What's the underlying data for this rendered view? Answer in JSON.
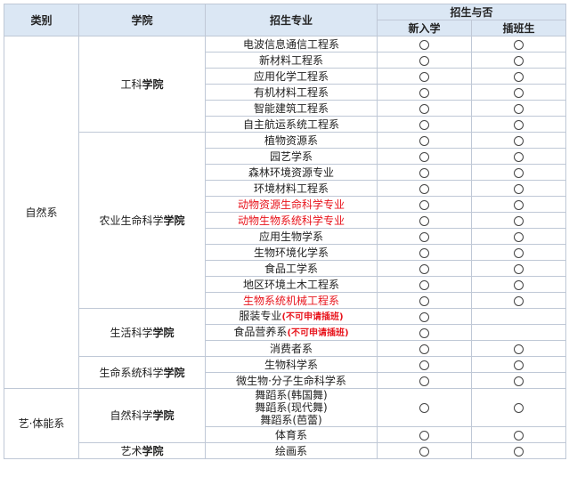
{
  "header": {
    "category": "类别",
    "college": "学院",
    "major": "招生专业",
    "admission": "招生与否",
    "freshman": "新入学",
    "transfer": "插班生"
  },
  "groups": [
    {
      "category": "自然系",
      "colleges": [
        {
          "name": "工科",
          "suffix": "学院",
          "majors": [
            {
              "name": "电波信息通信工程系",
              "red": false,
              "freshman": true,
              "transfer": true
            },
            {
              "name": "新材料工程系",
              "red": false,
              "freshman": true,
              "transfer": true
            },
            {
              "name": "应用化学工程系",
              "red": false,
              "freshman": true,
              "transfer": true
            },
            {
              "name": "有机材料工程系",
              "red": false,
              "freshman": true,
              "transfer": true
            },
            {
              "name": "智能建筑工程系",
              "red": false,
              "freshman": true,
              "transfer": true
            },
            {
              "name": "自主航运系统工程系",
              "red": false,
              "freshman": true,
              "transfer": true
            }
          ]
        },
        {
          "name": "农业生命科学",
          "suffix": "学院",
          "majors": [
            {
              "name": "植物资源系",
              "red": false,
              "freshman": true,
              "transfer": true
            },
            {
              "name": "园艺学系",
              "red": false,
              "freshman": true,
              "transfer": true
            },
            {
              "name": "森林环境资源专业",
              "red": false,
              "freshman": true,
              "transfer": true
            },
            {
              "name": "环境材料工程系",
              "red": false,
              "freshman": true,
              "transfer": true
            },
            {
              "name": "动物资源生命科学专业",
              "red": true,
              "freshman": true,
              "transfer": true
            },
            {
              "name": "动物生物系统科学专业",
              "red": true,
              "freshman": true,
              "transfer": true
            },
            {
              "name": "应用生物学系",
              "red": false,
              "freshman": true,
              "transfer": true
            },
            {
              "name": "生物环境化学系",
              "red": false,
              "freshman": true,
              "transfer": true
            },
            {
              "name": "食品工学系",
              "red": false,
              "freshman": true,
              "transfer": true
            },
            {
              "name": "地区环境土木工程系",
              "red": false,
              "freshman": true,
              "transfer": true
            },
            {
              "name": "生物系统机械工程系",
              "red": true,
              "freshman": true,
              "transfer": true
            }
          ]
        },
        {
          "name": "生活科学",
          "suffix": "学院",
          "majors": [
            {
              "name": "服装专业",
              "note": "(不可申请插班)",
              "red": false,
              "freshman": true,
              "transfer": false
            },
            {
              "name": "食品营养系",
              "note": "(不可申请插班)",
              "red": false,
              "freshman": true,
              "transfer": false
            },
            {
              "name": "消费者系",
              "red": false,
              "freshman": true,
              "transfer": true
            }
          ]
        },
        {
          "name": "生命系统科学",
          "suffix": "学院",
          "majors": [
            {
              "name": "生物科学系",
              "red": false,
              "freshman": true,
              "transfer": true
            },
            {
              "name": "微生物·分子生命科学系",
              "red": false,
              "freshman": true,
              "transfer": true
            }
          ]
        }
      ]
    },
    {
      "category": "艺·体能系",
      "colleges": [
        {
          "name": "自然科学",
          "suffix": "学院",
          "majors": [
            {
              "lines": [
                "舞蹈系(韩国舞)",
                "舞蹈系(现代舞)",
                "舞蹈系(芭蕾)"
              ],
              "red": false,
              "freshman": true,
              "transfer": true,
              "rowspan": 3
            },
            {
              "name": "体育系",
              "red": false,
              "freshman": true,
              "transfer": true
            }
          ]
        },
        {
          "name": "艺术",
          "suffix": "学院",
          "majors": [
            {
              "name": "绘画系",
              "red": false,
              "freshman": true,
              "transfer": true
            }
          ]
        }
      ]
    }
  ]
}
